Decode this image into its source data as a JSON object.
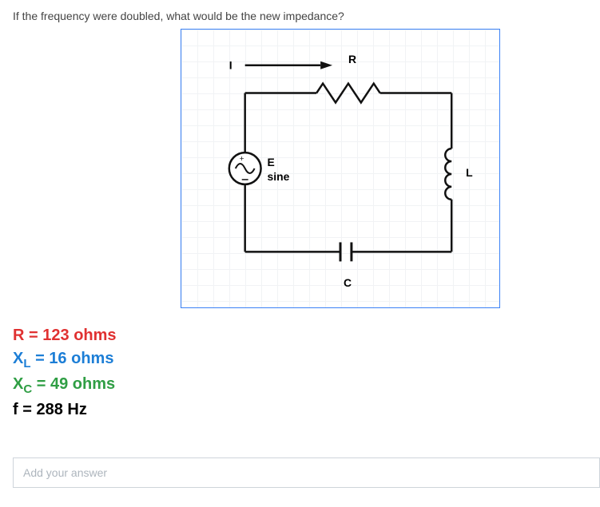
{
  "question": "If the frequency were doubled, what would be the new impedance?",
  "circuit": {
    "current_label": "I",
    "source_label_top": "E",
    "source_label_bottom": "sine",
    "resistor_label": "R",
    "inductor_label": "L",
    "capacitor_label": "C"
  },
  "parameters": {
    "R": {
      "symbol": "R",
      "value": "123",
      "unit": "ohms"
    },
    "XL": {
      "symbol": "X",
      "sub": "L",
      "value": "16",
      "unit": "ohms"
    },
    "XC": {
      "symbol": "X",
      "sub": "C",
      "value": "49",
      "unit": "ohms"
    },
    "f": {
      "symbol": "f",
      "value": "288",
      "unit": "Hz"
    }
  },
  "answer": {
    "placeholder": "Add your answer",
    "value": ""
  }
}
